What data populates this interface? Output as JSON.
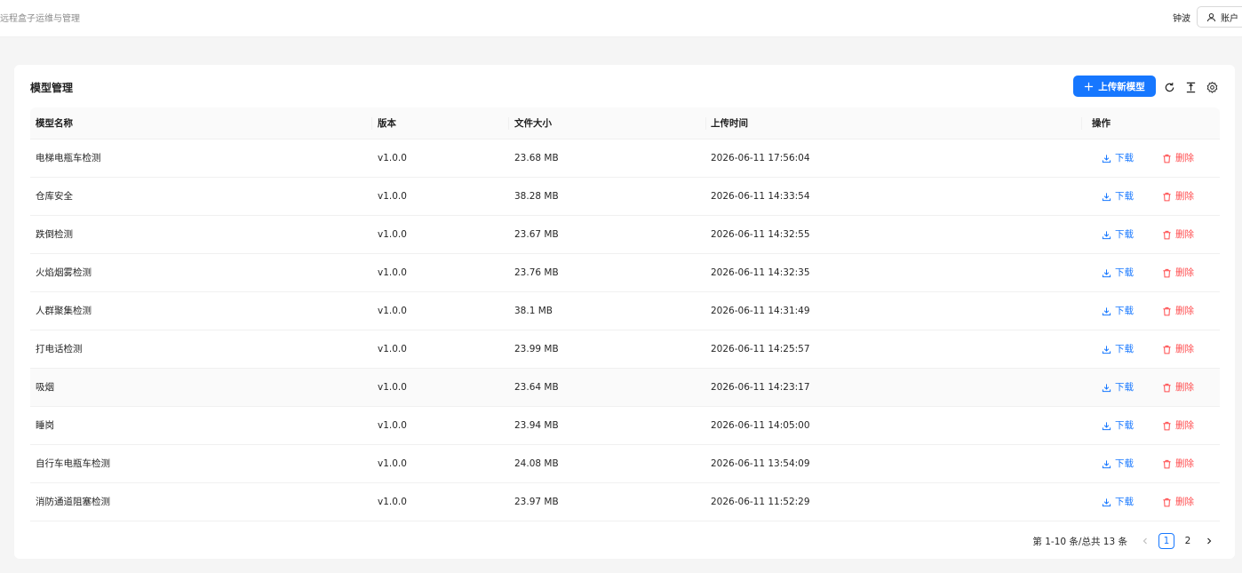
{
  "header": {
    "app_title": "远程盒子运维与管理",
    "user_name": "钟波",
    "account_label": "账户"
  },
  "card": {
    "title": "模型管理",
    "upload_label": "上传新模型"
  },
  "table": {
    "columns": [
      "模型名称",
      "版本",
      "文件大小",
      "上传时间",
      "操作"
    ],
    "rows": [
      {
        "name": "电梯电瓶车检测",
        "version": "v1.0.0",
        "size": "23.68 MB",
        "time": "2026-06-11 17:56:04"
      },
      {
        "name": "仓库安全",
        "version": "v1.0.0",
        "size": "38.28 MB",
        "time": "2026-06-11 14:33:54"
      },
      {
        "name": "跌倒检测",
        "version": "v1.0.0",
        "size": "23.67 MB",
        "time": "2026-06-11 14:32:55"
      },
      {
        "name": "火焰烟雾检测",
        "version": "v1.0.0",
        "size": "23.76 MB",
        "time": "2026-06-11 14:32:35"
      },
      {
        "name": "人群聚集检测",
        "version": "v1.0.0",
        "size": "38.1 MB",
        "time": "2026-06-11 14:31:49"
      },
      {
        "name": "打电话检测",
        "version": "v1.0.0",
        "size": "23.99 MB",
        "time": "2026-06-11 14:25:57"
      },
      {
        "name": "吸烟",
        "version": "v1.0.0",
        "size": "23.64 MB",
        "time": "2026-06-11 14:23:17"
      },
      {
        "name": "睡岗",
        "version": "v1.0.0",
        "size": "23.94 MB",
        "time": "2026-06-11 14:05:00"
      },
      {
        "name": "自行车电瓶车检测",
        "version": "v1.0.0",
        "size": "24.08 MB",
        "time": "2026-06-11 13:54:09"
      },
      {
        "name": "消防通道阻塞检测",
        "version": "v1.0.0",
        "size": "23.97 MB",
        "time": "2026-06-11 11:52:29"
      }
    ],
    "download_label": "下载",
    "delete_label": "删除"
  },
  "pagination": {
    "total_text": "第 1-10 条/总共 13 条",
    "pages": [
      "1",
      "2"
    ],
    "current": "1"
  },
  "colors": {
    "primary": "#1677ff",
    "danger": "#ff4d4f"
  }
}
